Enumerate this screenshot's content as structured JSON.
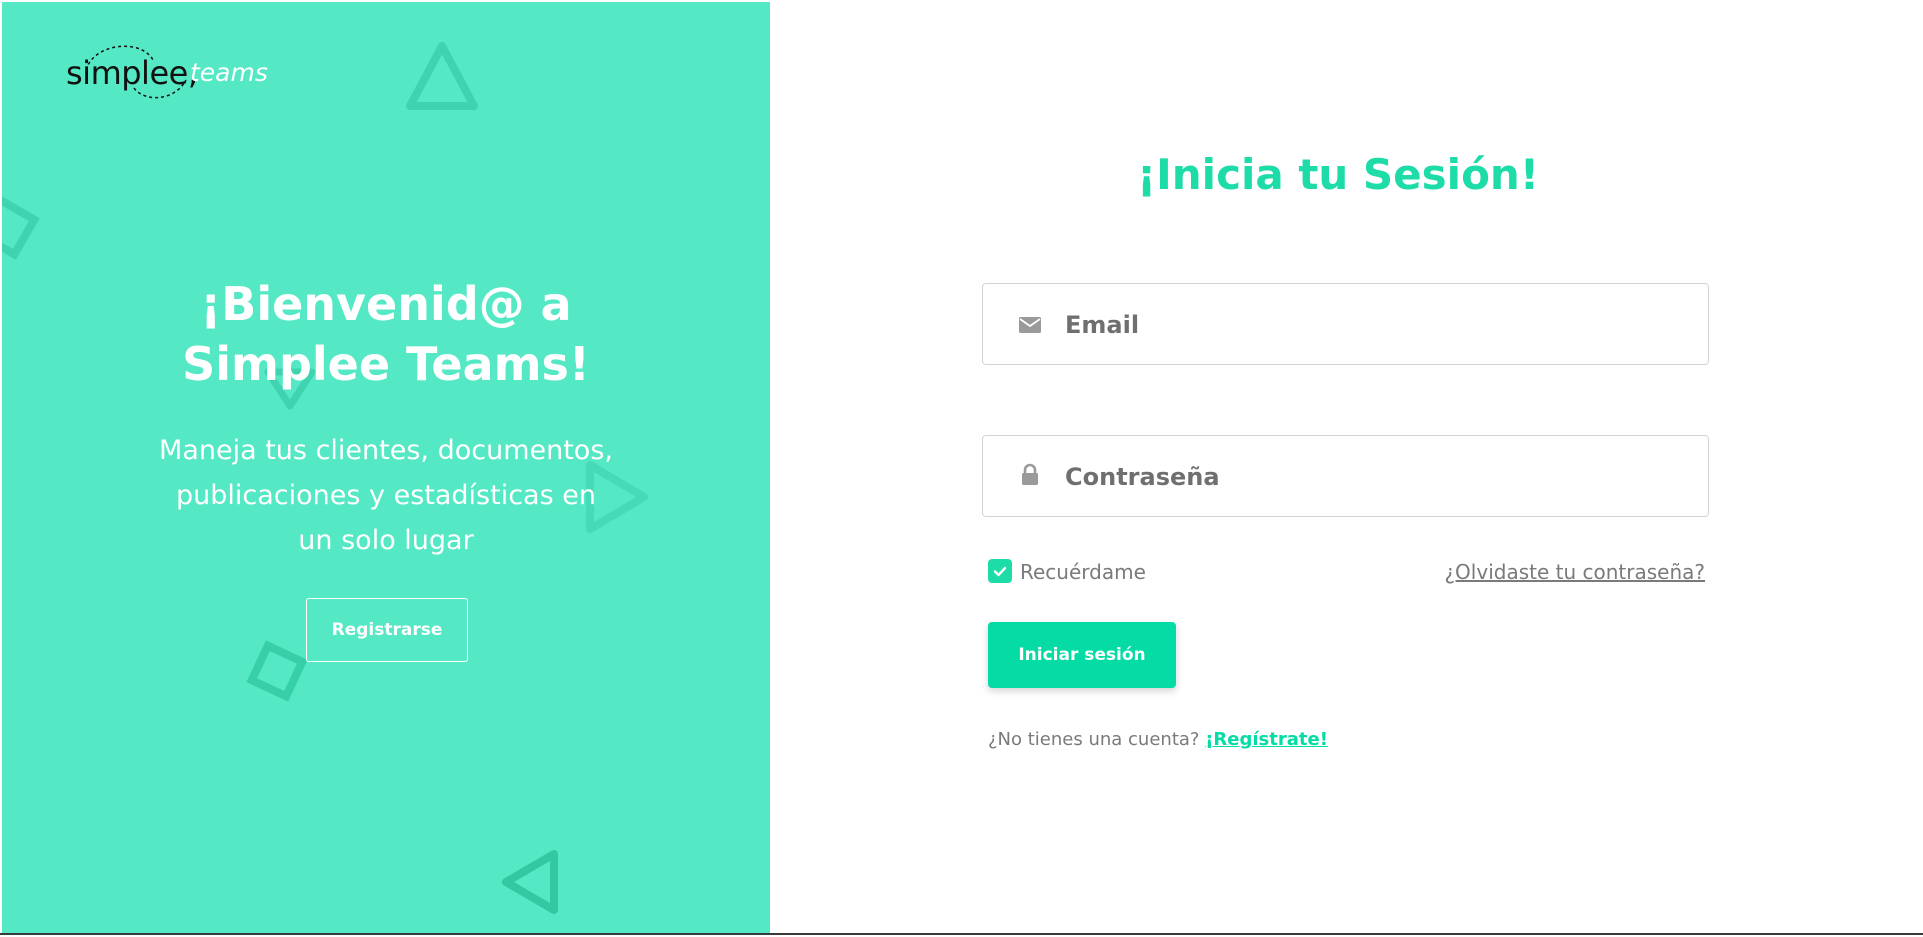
{
  "brand": {
    "logo_main": "simplee,",
    "logo_sub": "teams"
  },
  "left_panel": {
    "welcome_line1": "¡Bienvenid@ a",
    "welcome_line2": "Simplee Teams!",
    "subtitle_line1": "Maneja tus clientes, documentos,",
    "subtitle_line2": "publicaciones y estadísticas en",
    "subtitle_line3": "un solo lugar",
    "register_button": "Registrarse",
    "background_color": "#55e8c4"
  },
  "login": {
    "heading": "¡Inicia tu Sesión!",
    "email_placeholder": "Email",
    "password_placeholder": "Contraseña",
    "remember_label": "Recuérdame",
    "remember_checked": true,
    "forgot_link": "¿Olvidaste tu contraseña?",
    "login_button": "Iniciar sesión",
    "no_account_text": "¿No tienes una cuenta?",
    "signup_link": "¡Regístrate!",
    "accent_color": "#05dca5"
  },
  "icons": {
    "email": "envelope-icon",
    "password": "lock-icon",
    "checkbox": "check-icon"
  }
}
